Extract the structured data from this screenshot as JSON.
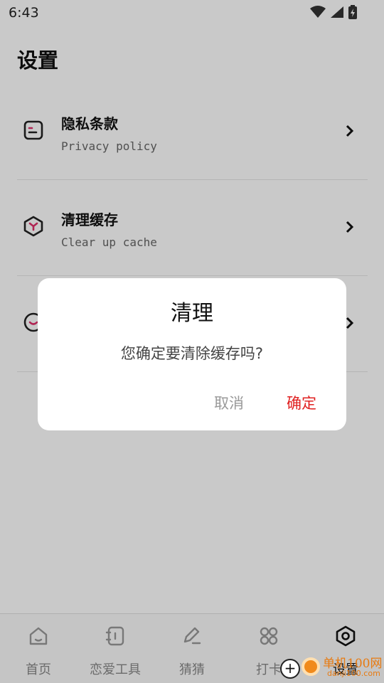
{
  "status_bar": {
    "time": "6:43"
  },
  "page": {
    "title": "设置"
  },
  "settings_items": [
    {
      "title": "隐私条款",
      "subtitle": "Privacy policy",
      "icon": "document-icon"
    },
    {
      "title": "清理缓存",
      "subtitle": "Clear up cache",
      "icon": "cube-icon"
    },
    {
      "title": "",
      "subtitle": "",
      "icon": "smile-icon"
    }
  ],
  "tab_bar": {
    "tabs": [
      {
        "label": "首页",
        "icon": "home-icon",
        "active": false
      },
      {
        "label": "恋爱工具",
        "icon": "notebook-icon",
        "active": false
      },
      {
        "label": "猜猜",
        "icon": "pen-icon",
        "active": false
      },
      {
        "label": "打卡",
        "icon": "grid-icon",
        "active": false
      },
      {
        "label": "设置",
        "icon": "hexagon-settings-icon",
        "active": true
      }
    ]
  },
  "dialog": {
    "title": "清理",
    "message": "您确定要清除缓存吗?",
    "cancel_label": "取消",
    "confirm_label": "确定"
  },
  "watermark": {
    "text": "单机100网",
    "sub": "danji100.com"
  },
  "colors": {
    "accent": "#e02020",
    "icon_pink": "#e0306a",
    "overlay": "#000000"
  }
}
